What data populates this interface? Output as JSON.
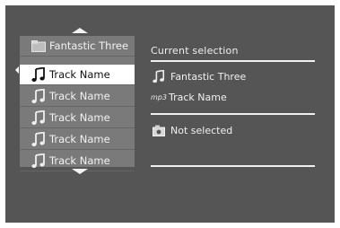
{
  "browser": {
    "folder": "Fantastic Three",
    "tracks": [
      "Track Name",
      "Track Name",
      "Track Name",
      "Track Name",
      "Track Name"
    ],
    "selected_index": 0
  },
  "info_panel": {
    "title": "Current selection",
    "album": "Fantastic Three",
    "format_tag": "mp3",
    "track": "Track Name",
    "status": "Not selected"
  },
  "icons": {
    "folder": "folder-icon",
    "track": "music-note-icon",
    "format": "mp3-icon",
    "status": "device-icon",
    "scroll_up": "arrow-up-icon",
    "scroll_down": "arrow-down-icon",
    "selection": "selection-marker-icon"
  },
  "colors": {
    "background": "#555555",
    "list_background": "#7a7a7a",
    "selected_row": "#ffffff",
    "text": "#f0f0f0"
  }
}
